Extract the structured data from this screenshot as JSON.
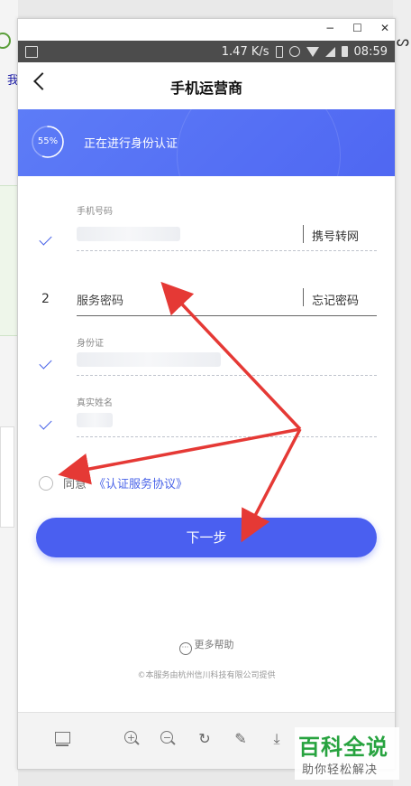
{
  "window": {
    "minimize": "−",
    "maximize": "☐",
    "close": "✕"
  },
  "statusbar": {
    "speed": "1.47 K/s",
    "time": "08:59"
  },
  "appbar": {
    "title": "手机运营商"
  },
  "banner": {
    "percent": "55%",
    "progress": 0.55,
    "message": "正在进行身份认证"
  },
  "form": {
    "phone": {
      "label": "手机号码",
      "aux": "携号转网"
    },
    "password": {
      "step": "2",
      "placeholder": "服务密码",
      "aux": "忘记密码"
    },
    "idcard": {
      "label": "身份证"
    },
    "realname": {
      "label": "真实姓名"
    }
  },
  "agreement": {
    "text": "同意",
    "link": "《认证服务协议》"
  },
  "next_button": "下一步",
  "help": {
    "label": "更多帮助",
    "icon": "···"
  },
  "footer_note": "©本服务由杭州信川科技有限公司提供",
  "background": {
    "left_text": "我"
  },
  "watermark": {
    "title": "百科全说",
    "subtitle": "助你轻松解决"
  },
  "colors": {
    "accent": "#4a5ff0",
    "banner": "#5a74f5",
    "arrow": "#e53935"
  }
}
